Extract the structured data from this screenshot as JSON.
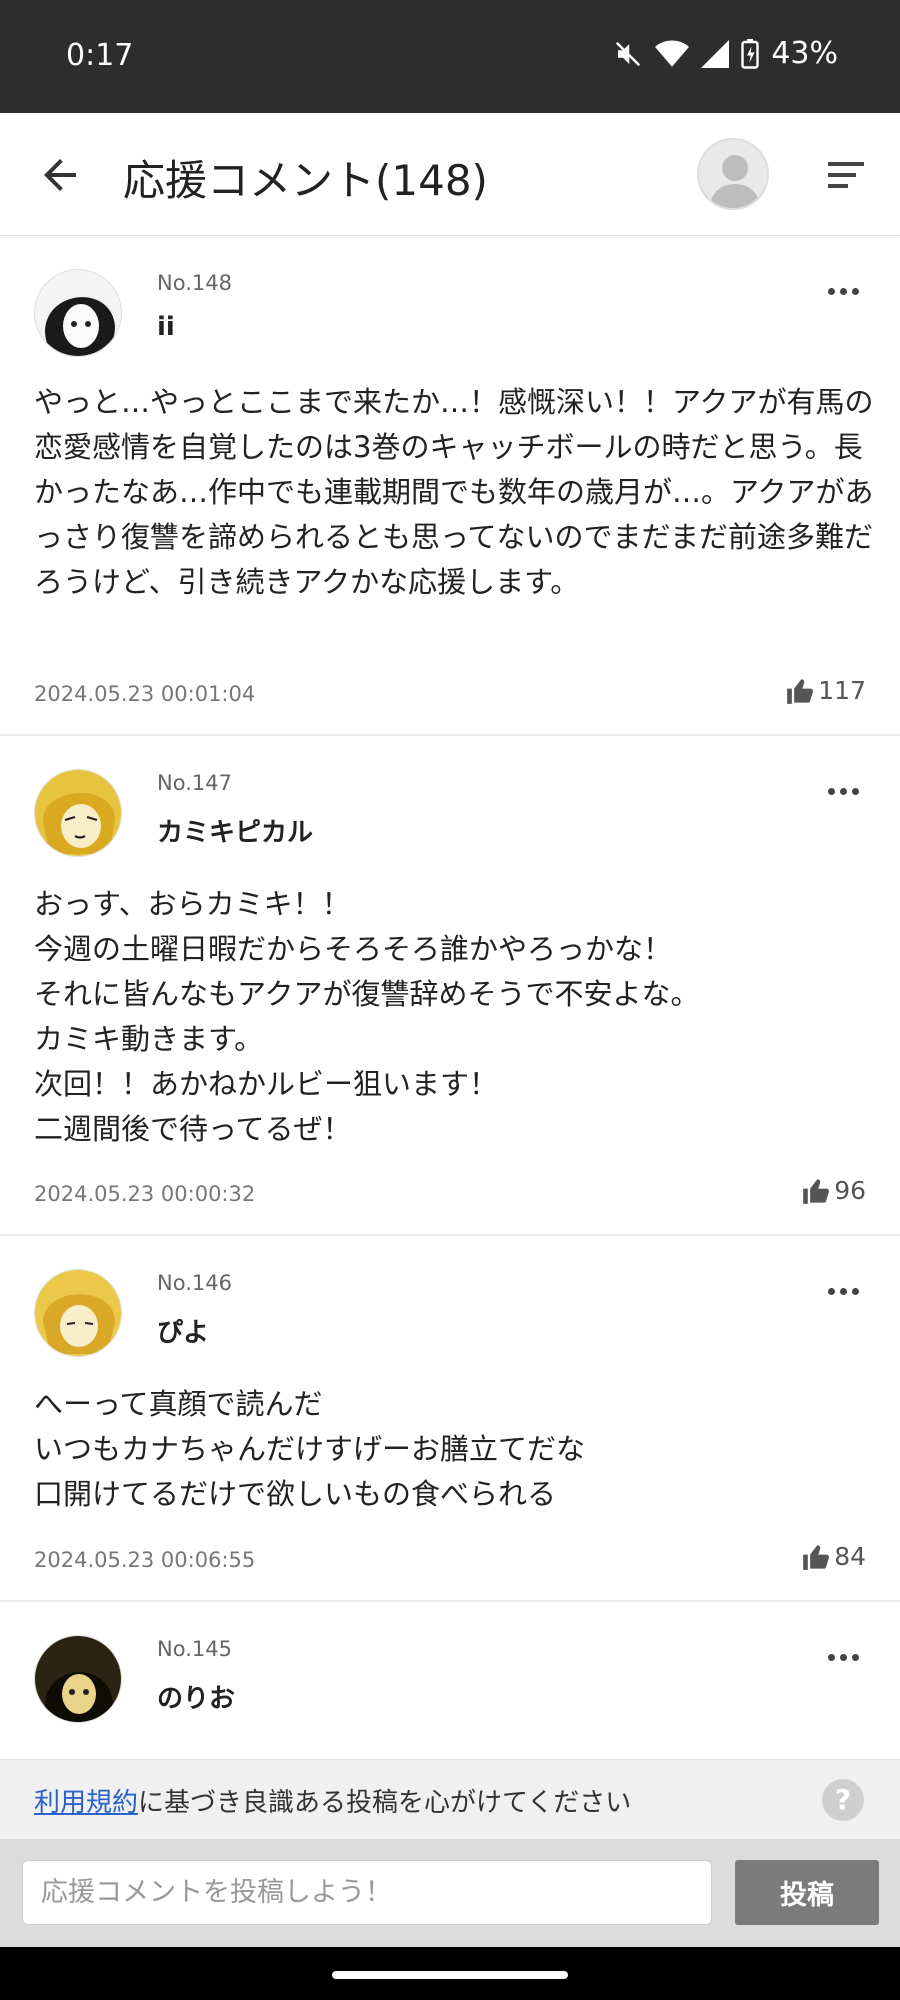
{
  "status_bar": {
    "time": "0:17",
    "battery": "43%"
  },
  "header": {
    "title": "応援コメント(148)"
  },
  "comments": [
    {
      "no": "No.148",
      "name": "ii",
      "body": "やっと…やっとここまで来たか…！感慨深い！！アクアが有馬の恋愛感情を自覚したのは3巻のキャッチボールの時だと思う。長かったなあ…作中でも連載期間でも数年の歳月が…。アクアがあっさり復讐を諦められるとも思ってないのでまだまだ前途多難だろうけど、引き続きアクかな応援します。",
      "date": "2024.05.23 00:01:04",
      "likes": "117"
    },
    {
      "no": "No.147",
      "name": "カミキピカル",
      "body": "おっす、おらカミキ！！\n今週の土曜日暇だからそろそろ誰かやろっかな！\nそれに皆んなもアクアが復讐辞めそうで不安よな。\nカミキ動きます。\n次回！！あかねかルビー狙います！\n二週間後で待ってるぜ！",
      "date": "2024.05.23 00:00:32",
      "likes": "96"
    },
    {
      "no": "No.146",
      "name": "ぴよ",
      "body": "へーって真顔で読んだ\nいつもカナちゃんだけすげーお膳立てだな\n口開けてるだけで欲しいもの食べられる",
      "date": "2024.05.23 00:06:55",
      "likes": "84"
    },
    {
      "no": "No.145",
      "name": "のりお",
      "body": "",
      "date": "",
      "likes": ""
    }
  ],
  "notice": {
    "link_text": "利用規約",
    "text": "に基づき良識ある投稿を心がけてください",
    "help": "?"
  },
  "input": {
    "placeholder": "応援コメントを投稿しよう！",
    "post_label": "投稿"
  }
}
